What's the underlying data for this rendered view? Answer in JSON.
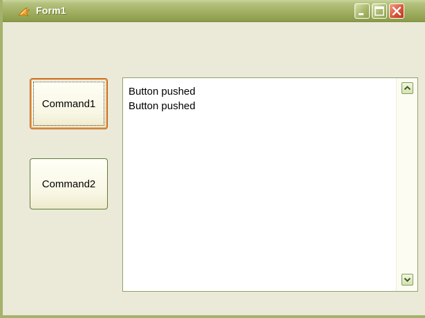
{
  "window": {
    "title": "Form1"
  },
  "buttons": {
    "command1": "Command1",
    "command2": "Command2"
  },
  "listbox": {
    "items": [
      "Button pushed",
      "Button pushed"
    ]
  },
  "icons": {
    "app": "app-icon",
    "minimize": "minimize-icon",
    "maximize": "maximize-icon",
    "close": "close-icon",
    "scroll_up": "scroll-up-icon",
    "scroll_down": "scroll-down-icon"
  },
  "colors": {
    "titlebar": "#a3b266",
    "window_bg": "#ebe9d8",
    "close_button": "#d9563a",
    "focus_border": "#b45a18"
  }
}
